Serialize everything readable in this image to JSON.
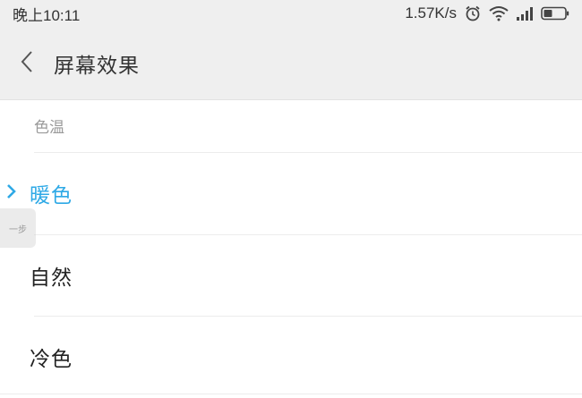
{
  "status_bar": {
    "time": "晚上10:11",
    "network_speed": "1.57K/s",
    "icons": [
      "alarm-icon",
      "wifi-icon",
      "signal-icon",
      "battery-icon"
    ]
  },
  "header": {
    "back_icon": "chevron-left-icon",
    "title": "屏幕效果"
  },
  "section": {
    "title": "色温"
  },
  "options": [
    {
      "label": "暖色",
      "selected": true
    },
    {
      "label": "自然",
      "selected": false
    },
    {
      "label": "冷色",
      "selected": false
    }
  ],
  "side_tab": {
    "label": "一步"
  },
  "colors": {
    "accent": "#2ea9e6",
    "bar_bg": "#efefef",
    "text": "#222222",
    "muted": "#9a9a9a"
  }
}
